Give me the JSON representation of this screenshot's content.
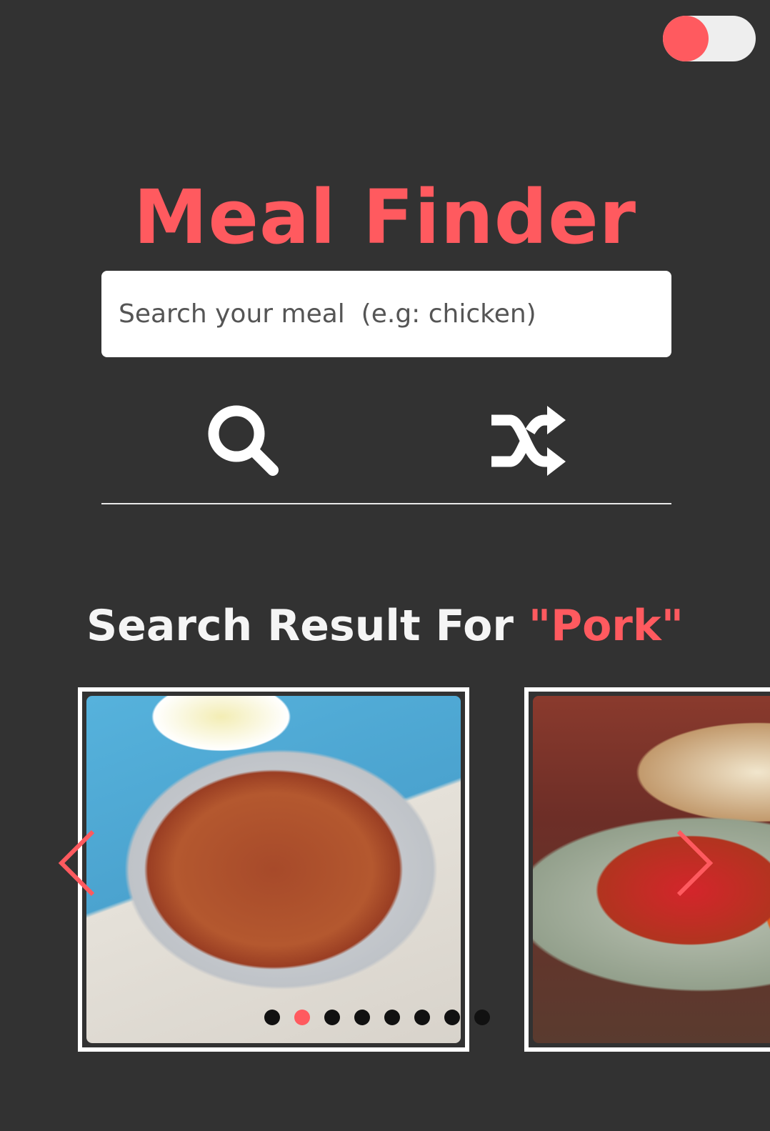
{
  "theme_toggle": {
    "state": "on",
    "accent_color": "#ff5a5f"
  },
  "header": {
    "title": "Meal Finder",
    "title_color": "#ff5a5f"
  },
  "search": {
    "placeholder": "Search your meal  (e.g: chicken)",
    "value": "",
    "search_icon": "search-icon",
    "random_icon": "shuffle-icon"
  },
  "results": {
    "prefix": "Search Result For",
    "term": "\"Pork\""
  },
  "carousel": {
    "prev_icon": "chevron-left-icon",
    "next_icon": "chevron-right-icon",
    "active_dot_index": 1,
    "dot_count": 8,
    "slides": [
      {
        "image": "sausage-bean-casserole-image"
      },
      {
        "image": "sweet-sour-pork-image"
      }
    ]
  },
  "colors": {
    "background": "#323232",
    "accent": "#ff5a5f",
    "text_light": "#f5f5f5"
  }
}
